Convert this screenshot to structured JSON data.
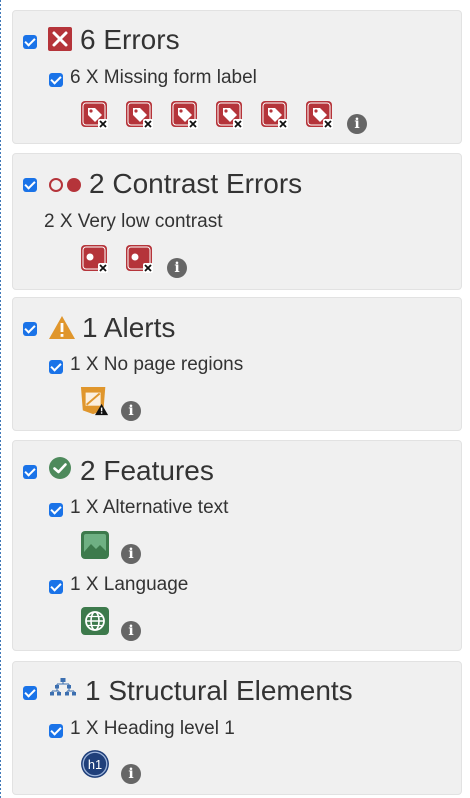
{
  "errors": {
    "title": "6 Errors",
    "items": [
      {
        "label": "6 X Missing form label",
        "icon_count": 6,
        "icon": "tag-error-icon"
      }
    ]
  },
  "contrast": {
    "title": "2 Contrast Errors",
    "items": [
      {
        "label": "2 X Very low contrast",
        "icon_count": 2,
        "icon": "contrast-error-icon"
      }
    ]
  },
  "alerts": {
    "title": "1 Alerts",
    "items": [
      {
        "label": "1 X No page regions",
        "icon_count": 1,
        "icon": "html5-alert-icon"
      }
    ]
  },
  "features": {
    "title": "2 Features",
    "items": [
      {
        "label": "1 X Alternative text",
        "icon_count": 1,
        "icon": "image-icon"
      },
      {
        "label": "1 X Language",
        "icon_count": 1,
        "icon": "globe-icon"
      }
    ]
  },
  "structure": {
    "title": "1 Structural Elements",
    "items": [
      {
        "label": "1 X Heading level 1",
        "icon_count": 1,
        "icon": "h1-icon"
      }
    ]
  },
  "info_glyph": "i",
  "heading_badge_text": "h1",
  "colors": {
    "error": "#b5343a",
    "alert": "#e0962c",
    "feature": "#4e8a5c",
    "structure": "#3c6fb0",
    "checkbox": "#1a73e8"
  }
}
